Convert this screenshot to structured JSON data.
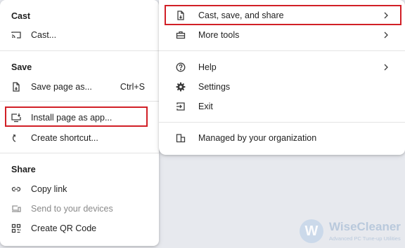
{
  "left_menu": {
    "cast": {
      "title": "Cast",
      "items": [
        {
          "label": "Cast...",
          "icon": "cast-icon"
        }
      ]
    },
    "save": {
      "title": "Save",
      "items": [
        {
          "label": "Save page as...",
          "shortcut": "Ctrl+S",
          "icon": "save-page-icon"
        },
        {
          "label": "Install page as app...",
          "icon": "install-app-icon",
          "highlighted": true
        },
        {
          "label": "Create shortcut...",
          "icon": "shortcut-arrow-icon"
        }
      ]
    },
    "share": {
      "title": "Share",
      "items": [
        {
          "label": "Copy link",
          "icon": "link-icon"
        },
        {
          "label": "Send to your devices",
          "icon": "devices-icon",
          "disabled": true
        },
        {
          "label": "Create QR Code",
          "icon": "qr-code-icon"
        }
      ]
    }
  },
  "right_menu": {
    "items": [
      {
        "label": "Cast, save, and share",
        "icon": "cast-save-share-icon",
        "submenu": true,
        "highlighted": true
      },
      {
        "label": "More tools",
        "icon": "toolbox-icon",
        "submenu": true
      },
      {
        "label": "Help",
        "icon": "help-icon",
        "submenu": true
      },
      {
        "label": "Settings",
        "icon": "gear-icon"
      },
      {
        "label": "Exit",
        "icon": "exit-icon"
      },
      {
        "label": "Managed by your organization",
        "icon": "building-icon"
      }
    ]
  },
  "watermark": {
    "logo_letter": "W",
    "name": "WiseCleaner",
    "tagline": "Advanced PC Tune-up Utilities"
  },
  "colors": {
    "highlight_border": "#d11f26",
    "menu_background": "#ffffff",
    "page_background": "#e7e9ee"
  }
}
